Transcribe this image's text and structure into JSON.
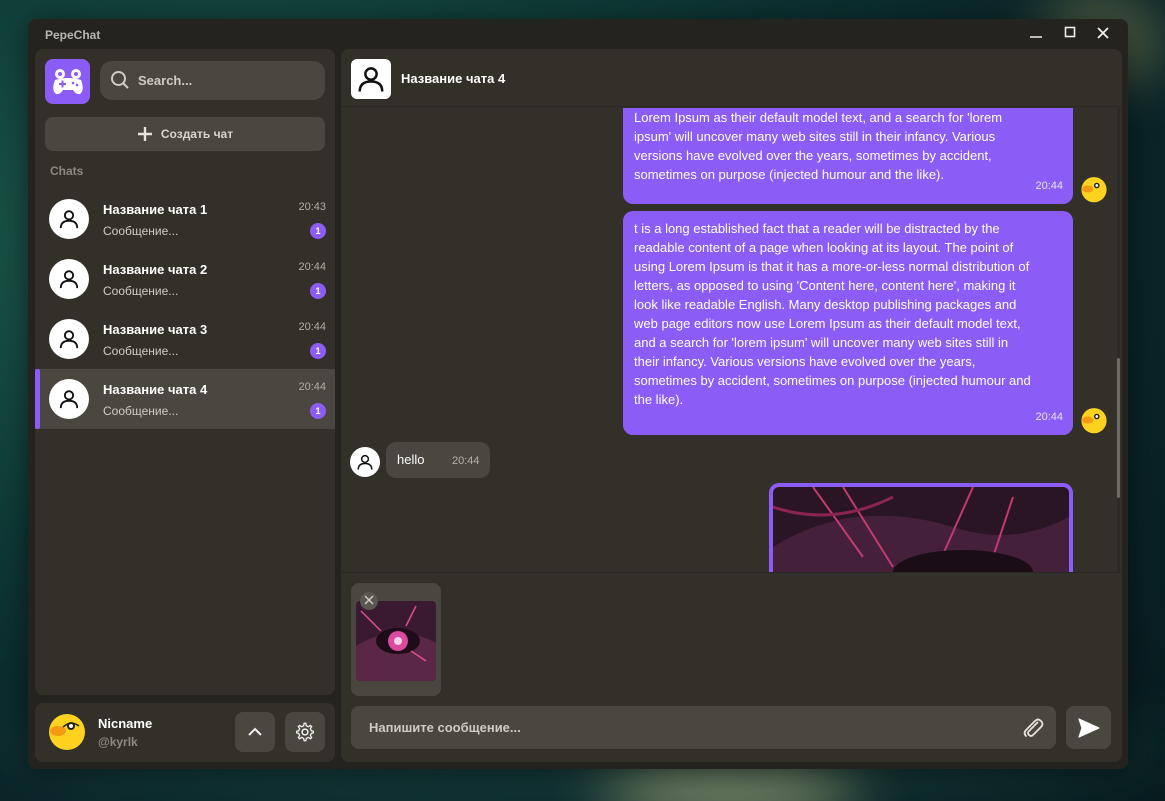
{
  "app": {
    "title": "PepeChat"
  },
  "sidebar": {
    "search_placeholder": "Search...",
    "create_chat_label": "Создать чат",
    "chats_section_label": "Chats",
    "chats": [
      {
        "name": "Название чата 1",
        "preview": "Сообщение...",
        "time": "20:43",
        "unread": "1",
        "active": false
      },
      {
        "name": "Название чата 2",
        "preview": "Сообщение...",
        "time": "20:44",
        "unread": "1",
        "active": false
      },
      {
        "name": "Название чата 3",
        "preview": "Сообщение...",
        "time": "20:44",
        "unread": "1",
        "active": false
      },
      {
        "name": "Название чата 4",
        "preview": "Сообщение...",
        "time": "20:44",
        "unread": "1",
        "active": true
      }
    ]
  },
  "user": {
    "name": "Nicname",
    "handle": "@kyrlk"
  },
  "chat": {
    "title": "Название чата 4",
    "messages": [
      {
        "direction": "out",
        "text": "Lorem Ipsum as their default model text, and a search for 'lorem ipsum' will uncover many web sites still in their infancy. Various versions have evolved over the years, sometimes by accident, sometimes on purpose (injected humour and the like).",
        "time": "20:44"
      },
      {
        "direction": "out",
        "text": "t is a long established fact that a reader will be distracted by the readable content of a page when looking at its layout. The point of using Lorem Ipsum is that it has a more-or-less normal distribution of letters, as opposed to using 'Content here, content here', making it look like readable English. Many desktop publishing packages and web page editors now use Lorem Ipsum as their default model text, and a search for 'lorem ipsum' will uncover many web sites still in their infancy. Various versions have evolved over the years, sometimes by accident, sometimes on purpose (injected humour and the like).",
        "time": "20:44"
      },
      {
        "direction": "in",
        "text": "hello",
        "time": "20:44"
      }
    ],
    "composer_placeholder": "Напишите сообщение..."
  },
  "colors": {
    "accent": "#8b5cf6",
    "panel": "#333029",
    "input": "#4a4640",
    "window": "#252320"
  },
  "icons": {
    "logo": "gamepad-frog-icon",
    "search": "search-icon",
    "create": "plus-icon",
    "avatar": "user-icon",
    "up": "chevron-up-icon",
    "settings": "gear-icon",
    "attach": "paperclip-icon",
    "send": "send-icon",
    "remove": "close-icon"
  }
}
